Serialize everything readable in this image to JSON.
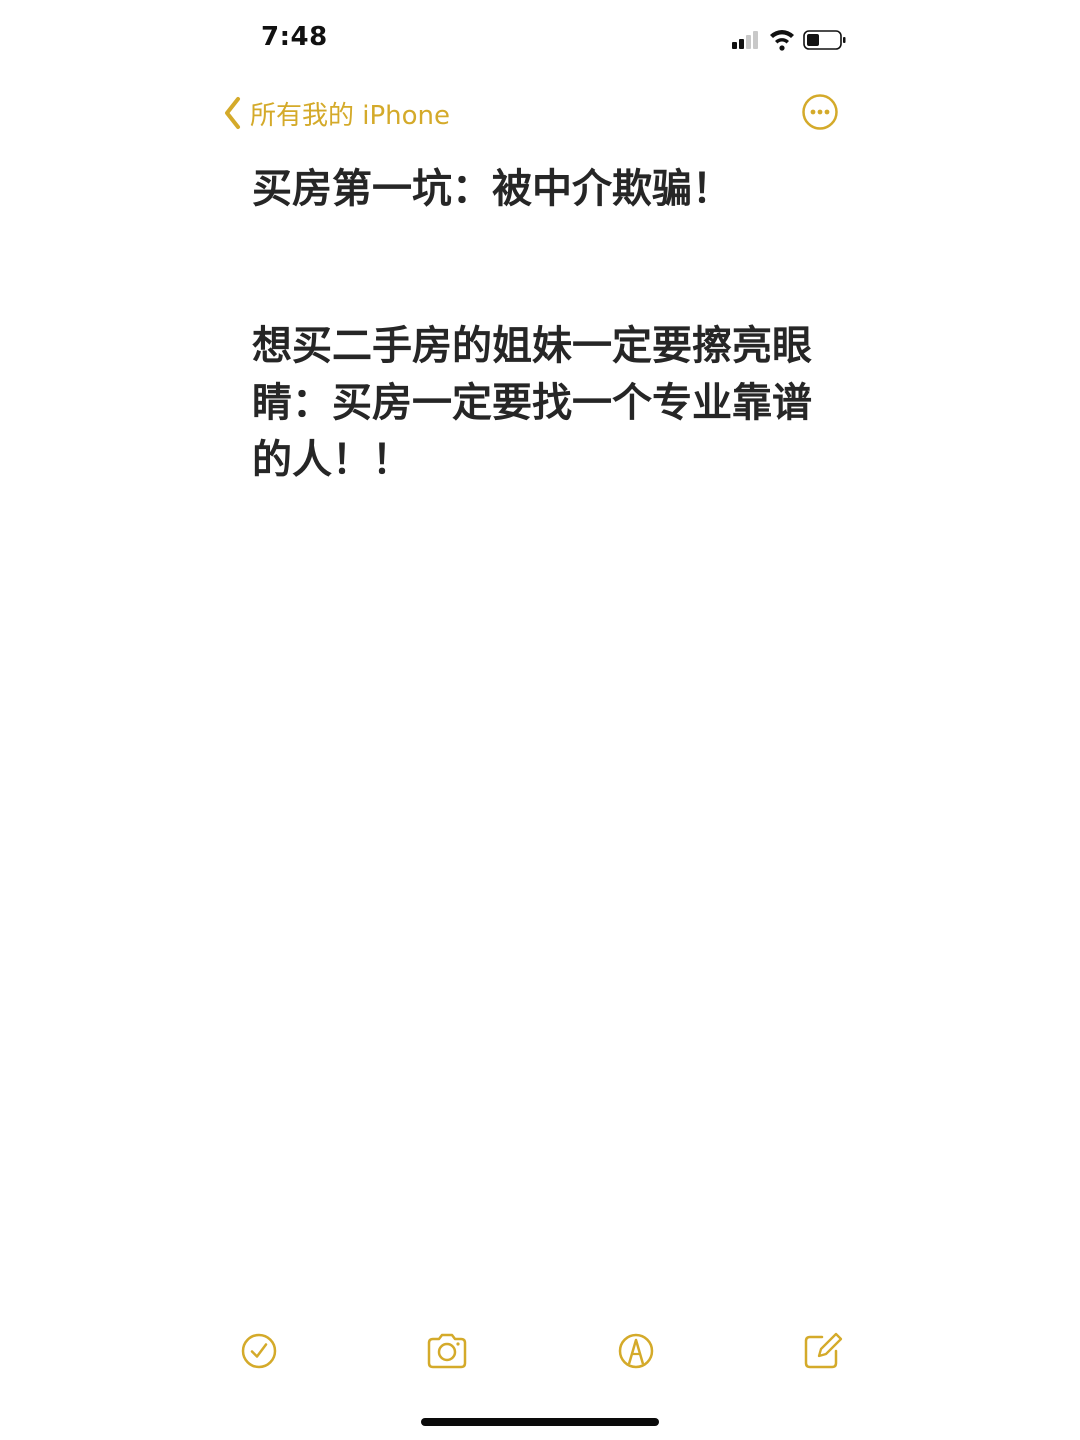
{
  "status_bar": {
    "time": "7:48",
    "icons": [
      "cellular-signal-icon",
      "wifi-icon",
      "battery-icon"
    ]
  },
  "nav": {
    "back_label": "所有我的 iPhone",
    "back_icon": "chevron-left-icon",
    "more_icon": "ellipsis-circle-icon"
  },
  "note": {
    "title": "买房第一坑：被中介欺骗！",
    "body": "想买二手房的姐妹一定要擦亮眼睛：买房一定要找一个专业靠谱的人！！"
  },
  "toolbar": {
    "items": [
      {
        "icon": "checklist-icon"
      },
      {
        "icon": "camera-icon"
      },
      {
        "icon": "markup-pen-icon"
      },
      {
        "icon": "compose-icon"
      }
    ]
  },
  "colors": {
    "accent": "#d4aa2a",
    "text": "#262626",
    "background": "#ffffff"
  }
}
